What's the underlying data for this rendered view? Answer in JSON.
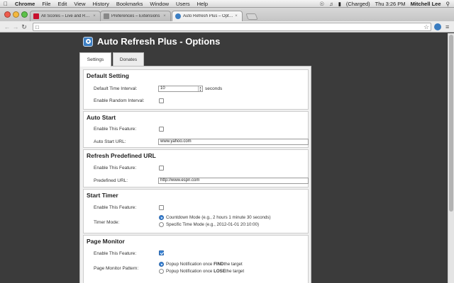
{
  "menubar": {
    "apple": "",
    "app": "Chrome",
    "items": [
      "File",
      "Edit",
      "View",
      "History",
      "Bookmarks",
      "Window",
      "Users",
      "Help"
    ],
    "battery": "(Charged)",
    "clock": "Thu 3:26 PM",
    "user": "Mitchell Lee"
  },
  "browser": {
    "tabs": [
      {
        "title": "All Scores – Live and Recent",
        "favicon_color": "#c8102e"
      },
      {
        "title": "Preferences – Extensions",
        "favicon_color": "#888888"
      },
      {
        "title": "Auto Refresh Plus – Options",
        "favicon_color": "#3c7fc4"
      }
    ],
    "url": ""
  },
  "page": {
    "title": "Auto Refresh Plus - Options",
    "tabs": [
      "Settings",
      "Donates"
    ]
  },
  "sections": {
    "default_setting": {
      "title": "Default Setting",
      "interval_label": "Default Time Interval:",
      "interval_value": "10",
      "interval_unit": "seconds",
      "random_label": "Enable Random Interval:",
      "random_checked": false
    },
    "auto_start": {
      "title": "Auto Start",
      "enable_label": "Enable This Feature:",
      "enable_checked": false,
      "url_label": "Auto Start URL:",
      "url_value": "www.yahoo.com"
    },
    "predefined_url": {
      "title": "Refresh Predefined URL",
      "enable_label": "Enable This Feature:",
      "enable_checked": false,
      "url_label": "Predefined URL:",
      "url_value": "http://www.espn.com"
    },
    "start_timer": {
      "title": "Start Timer",
      "enable_label": "Enable This Feature:",
      "enable_checked": false,
      "mode_label": "Timer Mode:",
      "mode_countdown": "Countdown Mode (e.g., 2 hours 1 minute 30 seconds)",
      "mode_specific": "Specific Time Mode (e.g., 2012-01-01 20:10:00)",
      "selected": "countdown"
    },
    "page_monitor": {
      "title": "Page Monitor",
      "enable_label": "Enable This Feature:",
      "enable_checked": true,
      "pattern_label": "Page Monitor Pattern:",
      "find_prefix": "Popup Notification once ",
      "find_bold": "FIND",
      "find_suffix": " the target",
      "lose_prefix": "Popup Notification once ",
      "lose_bold": "LOSE",
      "lose_suffix": " the target",
      "selected": "find"
    }
  }
}
